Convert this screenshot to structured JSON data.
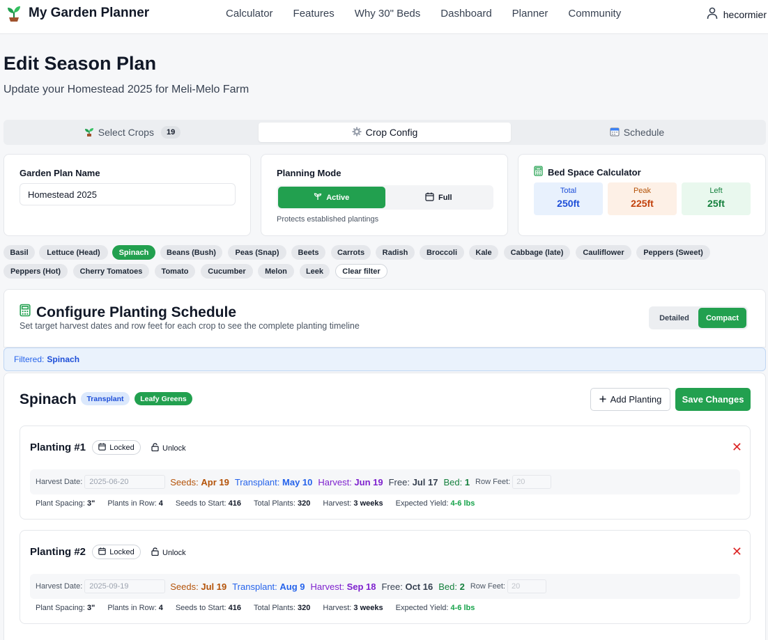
{
  "app": {
    "brand_title": "My Garden Planner",
    "nav": [
      "Calculator",
      "Features",
      "Why 30\" Beds",
      "Dashboard",
      "Planner",
      "Community"
    ],
    "username": "hecormier"
  },
  "page": {
    "title": "Edit Season Plan",
    "subtitle": "Update your Homestead 2025 for Meli-Melo Farm"
  },
  "tabs": [
    {
      "label": "Select Crops",
      "count": "19"
    },
    {
      "label": "Crop Config"
    },
    {
      "label": "Schedule"
    }
  ],
  "plan_name": {
    "label": "Garden Plan Name",
    "value": "Homestead 2025"
  },
  "planning_mode": {
    "label": "Planning Mode",
    "active_label": "Active",
    "full_label": "Full",
    "hint": "Protects established plantings"
  },
  "bed_space": {
    "title": "Bed Space Calculator",
    "total_label": "Total",
    "total_value": "250ft",
    "peak_label": "Peak",
    "peak_value": "225ft",
    "left_label": "Left",
    "left_value": "25ft"
  },
  "crop_filters": [
    "Basil",
    "Lettuce (Head)",
    "Spinach",
    "Beans (Bush)",
    "Peas (Snap)",
    "Beets",
    "Carrots",
    "Radish",
    "Broccoli",
    "Kale",
    "Cabbage (late)",
    "Cauliflower",
    "Peppers (Sweet)",
    "Peppers (Hot)",
    "Cherry Tomatoes",
    "Tomato",
    "Cucumber",
    "Melon",
    "Leek",
    "Clear filter"
  ],
  "active_filter": "Spinach",
  "config": {
    "title": "Configure Planting Schedule",
    "subtitle": "Set target harvest dates and row feet for each crop to see the complete planting timeline",
    "view_detailed": "Detailed",
    "view_compact": "Compact"
  },
  "filter_banner": {
    "label": "Filtered:",
    "value": "Spinach"
  },
  "crop": {
    "name": "Spinach",
    "badge_method": "Transplant",
    "badge_category": "Leafy Greens",
    "add_planting_label": "Add Planting",
    "save_label": "Save Changes"
  },
  "plantings": [
    {
      "title": "Planting #1",
      "locked_label": "Locked",
      "unlock_label": "Unlock",
      "harvest_date_label": "Harvest Date:",
      "harvest_date": "2025-06-20",
      "seeds_label": "Seeds:",
      "seeds": "Apr 19",
      "transplant_label": "Transplant:",
      "transplant": "May 10",
      "harvest_label": "Harvest:",
      "harvest": "Jun 19",
      "free_label": "Free:",
      "free": "Jul 17",
      "bed_label": "Bed:",
      "bed": "1",
      "row_feet_label": "Row Feet:",
      "row_feet": "20",
      "spacing_label": "Plant Spacing:",
      "spacing": "3\"",
      "plants_in_row_label": "Plants in Row:",
      "plants_in_row": "4",
      "seeds_to_start_label": "Seeds to Start:",
      "seeds_to_start": "416",
      "total_plants_label": "Total Plants:",
      "total_plants": "320",
      "harvest_dur_label": "Harvest:",
      "harvest_dur": "3 weeks",
      "yield_label": "Expected Yield:",
      "yield": "4-6 lbs"
    },
    {
      "title": "Planting #2",
      "locked_label": "Locked",
      "unlock_label": "Unlock",
      "harvest_date_label": "Harvest Date:",
      "harvest_date": "2025-09-19",
      "seeds_label": "Seeds:",
      "seeds": "Jul 19",
      "transplant_label": "Transplant:",
      "transplant": "Aug 9",
      "harvest_label": "Harvest:",
      "harvest": "Sep 18",
      "free_label": "Free:",
      "free": "Oct 16",
      "bed_label": "Bed:",
      "bed": "2",
      "row_feet_label": "Row Feet:",
      "row_feet": "20",
      "spacing_label": "Plant Spacing:",
      "spacing": "3\"",
      "plants_in_row_label": "Plants in Row:",
      "plants_in_row": "4",
      "seeds_to_start_label": "Seeds to Start:",
      "seeds_to_start": "416",
      "total_plants_label": "Total Plants:",
      "total_plants": "320",
      "harvest_dur_label": "Harvest:",
      "harvest_dur": "3 weeks",
      "yield_label": "Expected Yield:",
      "yield": "4-6 lbs"
    }
  ],
  "colors": {
    "accent_green": "#22a04f",
    "seeds": "#b45309",
    "transplant": "#2563eb",
    "harvest": "#7e22ce",
    "free": "#374151",
    "bed": "#15803d",
    "danger": "#dc2626"
  }
}
